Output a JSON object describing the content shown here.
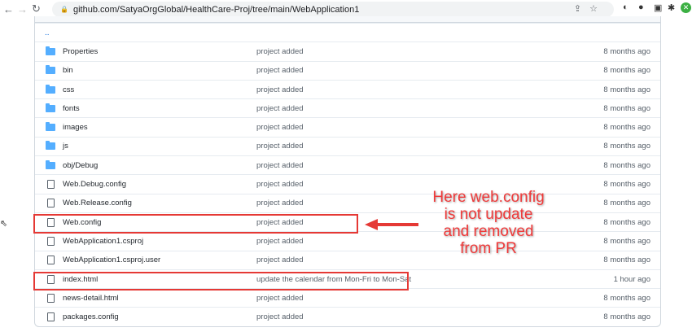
{
  "browser": {
    "url": "github.com/SatyaOrgGlobal/HealthCare-Proj/tree/main/WebApplication1"
  },
  "parent_link": "..",
  "files": [
    {
      "name": "Properties",
      "type": "folder",
      "message": "project added",
      "age": "8 months ago"
    },
    {
      "name": "bin",
      "type": "folder",
      "message": "project added",
      "age": "8 months ago"
    },
    {
      "name": "css",
      "type": "folder",
      "message": "project added",
      "age": "8 months ago"
    },
    {
      "name": "fonts",
      "type": "folder",
      "message": "project added",
      "age": "8 months ago"
    },
    {
      "name": "images",
      "type": "folder",
      "message": "project added",
      "age": "8 months ago"
    },
    {
      "name": "js",
      "type": "folder",
      "message": "project added",
      "age": "8 months ago"
    },
    {
      "name": "obj/Debug",
      "type": "folder",
      "message": "project added",
      "age": "8 months ago"
    },
    {
      "name": "Web.Debug.config",
      "type": "file",
      "message": "project added",
      "age": "8 months ago"
    },
    {
      "name": "Web.Release.config",
      "type": "file",
      "message": "project added",
      "age": "8 months ago"
    },
    {
      "name": "Web.config",
      "type": "file",
      "message": "project added",
      "age": "8 months ago"
    },
    {
      "name": "WebApplication1.csproj",
      "type": "file",
      "message": "project added",
      "age": "8 months ago"
    },
    {
      "name": "WebApplication1.csproj.user",
      "type": "file",
      "message": "project added",
      "age": "8 months ago"
    },
    {
      "name": "index.html",
      "type": "file",
      "message": "update the calendar from Mon-Fri to Mon-Sat",
      "age": "1 hour ago"
    },
    {
      "name": "news-detail.html",
      "type": "file",
      "message": "project added",
      "age": "8 months ago"
    },
    {
      "name": "packages.config",
      "type": "file",
      "message": "project added",
      "age": "8 months ago"
    }
  ],
  "annotation": {
    "lines": [
      "Here web.config",
      "is not update",
      "and removed",
      "from PR"
    ],
    "color": "#e53935"
  }
}
